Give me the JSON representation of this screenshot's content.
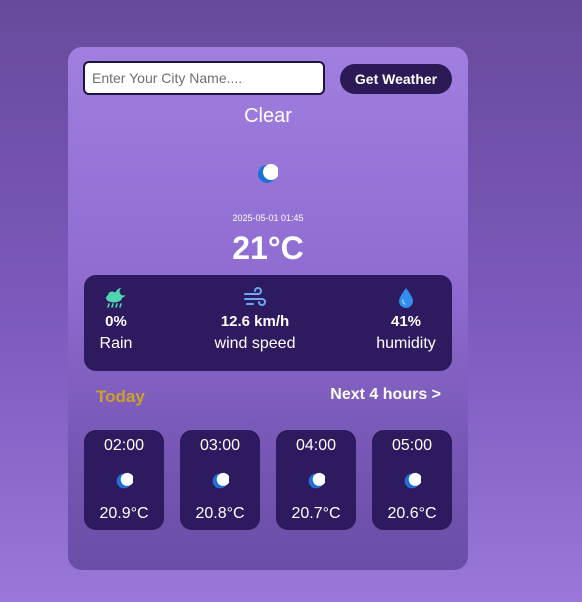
{
  "search": {
    "placeholder": "Enter Your City Name....",
    "button_label": "Get Weather"
  },
  "current": {
    "condition": "Clear",
    "icon": "crescent-moon-icon",
    "datetime": "2025-05-01 01:45",
    "temperature": "21°C"
  },
  "stats": {
    "rain": {
      "icon": "cloud-rain-moon-icon",
      "value": "0%",
      "label": "Rain"
    },
    "wind": {
      "icon": "wind-icon",
      "value": "12.6 km/h",
      "label": "wind speed"
    },
    "humidity": {
      "icon": "droplet-icon",
      "value": "41%",
      "label": "humidity"
    }
  },
  "tabs": {
    "today": "Today",
    "next": "Next 4 hours >"
  },
  "hourly": [
    {
      "time": "02:00",
      "icon": "crescent-moon-icon",
      "temp": "20.9°C"
    },
    {
      "time": "03:00",
      "icon": "crescent-moon-icon",
      "temp": "20.8°C"
    },
    {
      "time": "04:00",
      "icon": "crescent-moon-icon",
      "temp": "20.7°C"
    },
    {
      "time": "05:00",
      "icon": "crescent-moon-icon",
      "temp": "20.6°C"
    }
  ],
  "colors": {
    "accent_dark": "#2e1a5e",
    "today_tab": "#c9a227",
    "moon_icon": "#1e6fd6",
    "rain_icon": "#4fd6b0",
    "wind_icon": "#6aa8f5",
    "drop_icon": "#2f8ef0"
  }
}
